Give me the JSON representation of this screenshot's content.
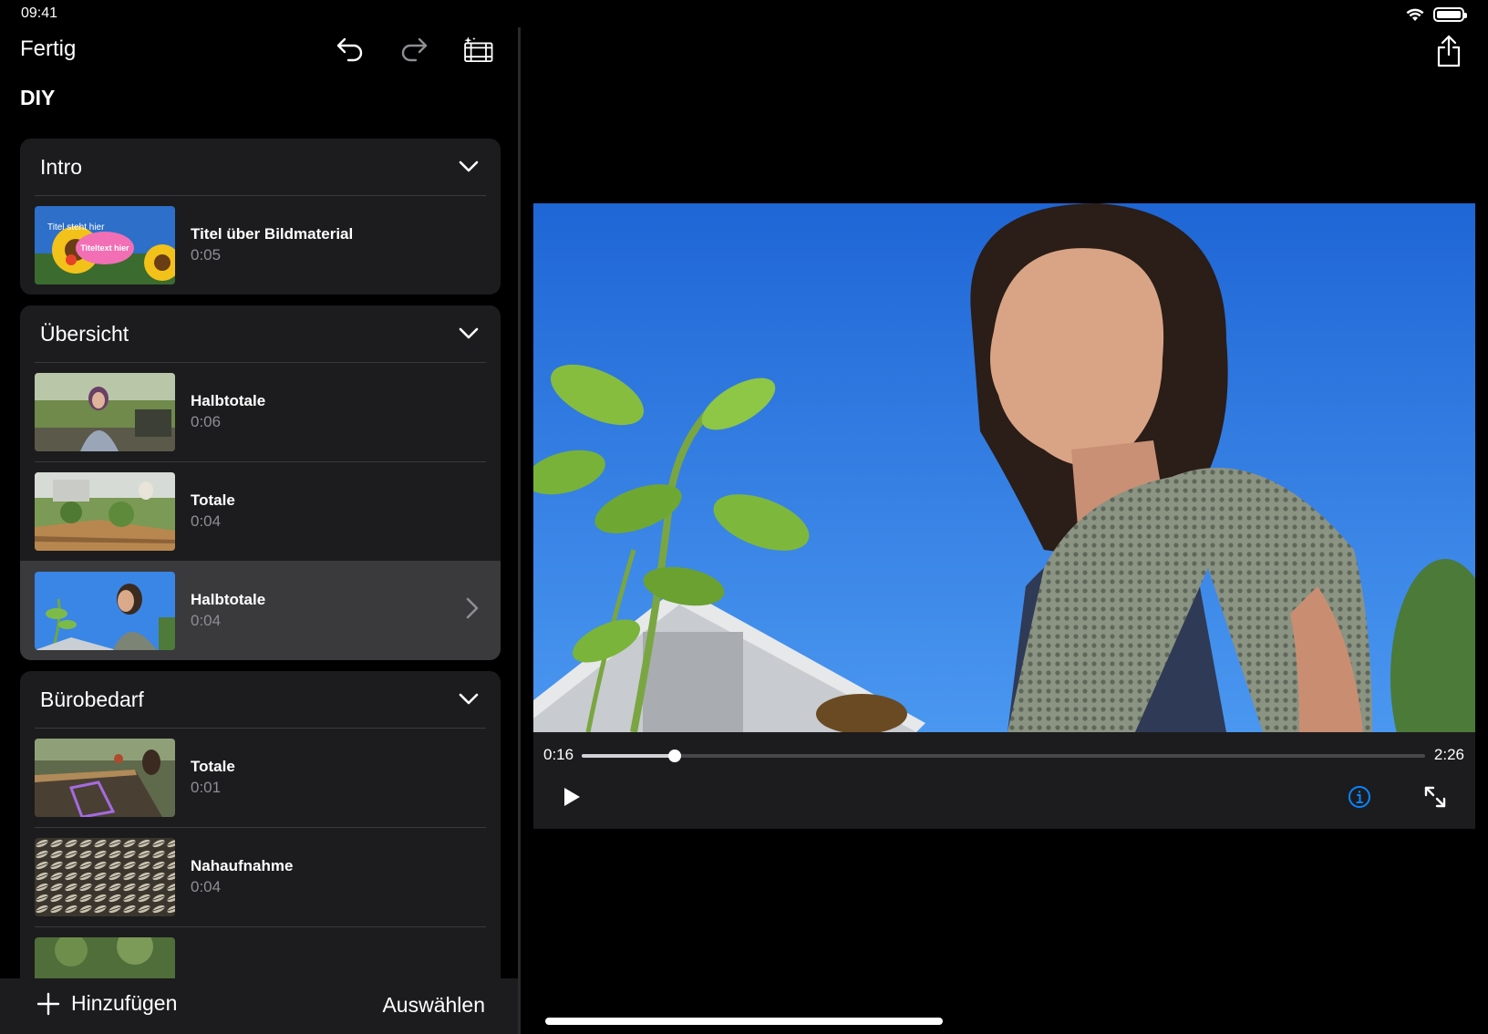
{
  "status_bar": {
    "time": "09:41"
  },
  "toolbar": {
    "done_label": "Fertig",
    "project_title": "DIY",
    "icons": [
      "undo-icon",
      "redo-icon",
      "magic-movie-icon",
      "share-icon"
    ]
  },
  "sections": [
    {
      "title": "Intro",
      "clips": [
        {
          "name": "Titel über Bildmaterial",
          "duration": "0:05",
          "thumb_title_top": "Titel steht hier",
          "thumb_title_bubble": "Titeltext hier"
        }
      ]
    },
    {
      "title": "Übersicht",
      "clips": [
        {
          "name": "Halbtotale",
          "duration": "0:06"
        },
        {
          "name": "Totale",
          "duration": "0:04"
        },
        {
          "name": "Halbtotale",
          "duration": "0:04",
          "selected": true
        }
      ]
    },
    {
      "title": "Bürobedarf",
      "clips": [
        {
          "name": "Totale",
          "duration": "0:01"
        },
        {
          "name": "Nahaufnahme",
          "duration": "0:04"
        }
      ]
    }
  ],
  "bottom_bar": {
    "add_label": "Hinzufügen",
    "select_label": "Auswählen"
  },
  "player": {
    "current_time": "0:16",
    "total_time": "2:26",
    "progress_fraction": 0.11
  },
  "colors": {
    "accent": "#0a84ff",
    "panel": "#1c1c1e",
    "selected_row": "#3a3a3c"
  }
}
